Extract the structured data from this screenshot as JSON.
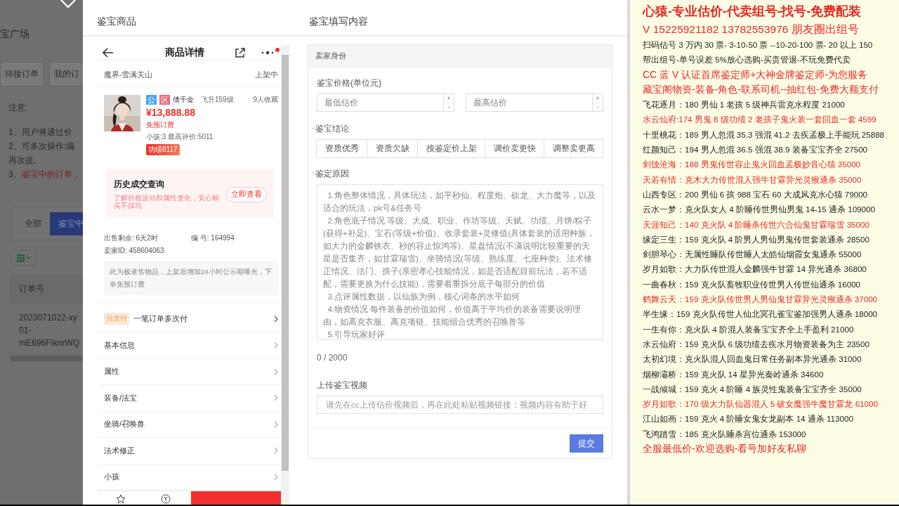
{
  "backdrop": {
    "page_title": "宝广场",
    "tabs": [
      "待接订单",
      "我的订"
    ],
    "notice_title": "注意:",
    "notice_lines": [
      {
        "number": "1、",
        "text": "用户将通过价",
        "kind": "normal"
      },
      {
        "number": "2、",
        "text": "可多次操作:编",
        "kind": "normal"
      },
      {
        "text": "再次提。",
        "kind": "normal"
      },
      {
        "number": "3、",
        "text": "鉴宝中的订单，",
        "kind": "warning"
      }
    ],
    "filters": [
      {
        "label": "全部",
        "selected": false
      },
      {
        "label": "鉴宝中",
        "selected": true
      }
    ],
    "table": {
      "columns": [
        "订单号"
      ],
      "rows": [
        [
          [
            "2023071022-xy",
            "01-",
            "mE696FIknrWQ"
          ]
        ]
      ]
    }
  },
  "modal": {
    "left_title": "鉴宝商品",
    "right_title": "鉴宝填写内容"
  },
  "product": {
    "header_title": "商品详情",
    "server": "魔界-雪满关山",
    "status": "上架中",
    "badges": [
      {
        "text": "公",
        "color": "#4aa8f0"
      },
      {
        "text": "区",
        "color": "#f06a7a"
      }
    ],
    "name": "倩千金",
    "level": "飞升159级",
    "favorites": "9人收藏",
    "price": "¥13,888.88",
    "fee": "免预订费",
    "stats": "小孩:3 最高评价:5011",
    "merit": "功绩8117",
    "history": {
      "title": "历史成交查询",
      "subtitle": "了解价格波动和属性变化，安心购买不踩坑",
      "button": "立即查看"
    },
    "remaining": "出售剩余: 6天2时",
    "serial": "编 号: 164994",
    "seller": "卖家ID: 458604063",
    "note": "此为极速售物品，上架后增加24小时公示期曝光，下单免预订费",
    "installment": {
      "badge": "分次付",
      "text": "一笔订单多次付"
    },
    "sections": [
      "基本信息",
      "属性",
      "装备/法宝",
      "坐骑/召唤兽",
      "法术修正",
      "小孩"
    ]
  },
  "form": {
    "section": "卖家身份",
    "price_label": "鉴宝价格(单位元)",
    "min_placeholder": "最低估价",
    "max_placeholder": "最高估价",
    "spin_up": "+",
    "spin_down": "-",
    "conclusion_label": "鉴宝结论",
    "required_mark": "*",
    "conclusions": [
      {
        "label": "资质优秀",
        "selected": false
      },
      {
        "label": "资质欠缺",
        "selected": false
      },
      {
        "label": "按鉴定价上架",
        "selected": false
      },
      {
        "label": "调价卖更快",
        "selected": false
      },
      {
        "label": "调整卖更高",
        "selected": false
      }
    ],
    "reason_label": "鉴定原因",
    "reason_placeholder": "  1.角色整体情况，具体玩法，如平秒仙、程度炮、砍龙、大力魔等，以及适合的玩法，pk号&任务号\n  2.角色底子情况 等级、大成、职业、作坊等级、天赋、功绩、月饼/粽子(获得+补足)、宝石(等级+价值)、收录套装+灵修值(具体套装的适用种族，如大力的金麟铁衣、秒的容止惊鸿等)、星盘情况(不满说明比较重要的天星是否集齐，如甘霖瑞雪)、坐骑情况(等级、熟练度、七座种类)、法术修正情况、法门、孩子(亲密孝心技能情况，如是否适配目前玩法，若不适配，需要更换为什么技能)，需要着重拆分底子每部分的价值\n  3.点评属性数据，以仙族为例，核心词条的水平如何\n  4.物资情况 每件装备的价值如何，价值高于平均价的装备需要说明理由，如高克衣服、高克项链、技能组合优秀的召唤兽等\n  5.引导玩家好评",
    "counter": "0 / 2000",
    "video_label": "上传鉴宝视频",
    "video_placeholder": "请先在cc上传估价视频后，再在此处粘贴视频链接；视频内容有助于好",
    "submit": "提交"
  },
  "notes": {
    "lines": [
      {
        "text": "心猿-专业估价-代卖组号-找号-免费配装",
        "color": "#e52b24",
        "kind": "title"
      },
      {
        "text": "V 15225921182   13782553976 朋友圈出组号",
        "color": "#e52b24",
        "kind": "subtitle"
      },
      {
        "text": "扫码估号 3 万内 30 票- 3-10-50 票  --10-20-100 票- 20 以上 150",
        "color": "#222222",
        "kind": "line"
      },
      {
        "text": "帮出组号-单号误差 5%放心选购-买贵管退-不玩免费代卖",
        "color": "#222222",
        "kind": "line"
      },
      {
        "text": "CC 蓝 V 认证首席鉴定师+大神金牌鉴定师-为您服务",
        "color": "#e52b24",
        "kind": "accent"
      },
      {
        "text": "藏宝阁物资-装备-角色-联系司机--抽红包-免费大额支付",
        "color": "#e52b24",
        "kind": "accent"
      },
      {
        "text": "飞花逐月：180 男仙 1 老孩 5 级神兵雷克水程度 21000",
        "color": "#222222",
        "kind": "line"
      },
      {
        "text": "水云仙府:174 男鬼 8 级功绩 2 老孩子鬼火装一套回血一套 4599",
        "color": "#e52b24",
        "kind": "line"
      },
      {
        "text": "十里桃花：189 男人忽混 35.3 强混 41.2 去疾孟极上手能玩 25888",
        "color": "#222222",
        "kind": "line"
      },
      {
        "text": "红颜知己：194 男人忽混 36.5 强混 38.9 装备宝宝齐全 27500",
        "color": "#222222",
        "kind": "line"
      },
      {
        "text": "剑蚀沧海：188 男鬼传世容止鬼火回血孟极妙音心猿 35000",
        "color": "#e52b24",
        "kind": "line"
      },
      {
        "text": "天若有情：克木大力传世混人强牛甘霖异光灵猴通杀 35000",
        "color": "#e52b24",
        "kind": "line"
      },
      {
        "text": "山西专区：200 男仙 6 孩 988 宝石 60 大成风克水心猿 79000",
        "color": "#222222",
        "kind": "line"
      },
      {
        "text": "云水一梦：克火队女人 4 阶睡传世男仙男鬼 14-15 通杀 109000",
        "color": "#222222",
        "kind": "line"
      },
      {
        "text": "天涯知己：140 克火队 4 阶睡杀传世六合仙鬼甘霖瑞雪 35000",
        "color": "#e52b24",
        "kind": "line"
      },
      {
        "text": "缘定三生：159 克火队 4 阶男人男仙男鬼传世套装通杀 28500",
        "color": "#222222",
        "kind": "line"
      },
      {
        "text": "剑胆琴心：无属性睡队传世睡人太皓仙烟霞女鬼通杀 55000",
        "color": "#222222",
        "kind": "line"
      },
      {
        "text": "岁月如歌：大力队传世混人金麟强牛甘霖 14 异光通杀 36800",
        "color": "#222222",
        "kind": "line"
      },
      {
        "text": "一曲春秋：159 克火队畜牧职业传世男人传世仙通杀 16000",
        "color": "#222222",
        "kind": "line"
      },
      {
        "text": "鹤舞云天：159 克火队传世男人男仙鬼甘霖异光灵猴通杀 37000",
        "color": "#e52b24",
        "kind": "line"
      },
      {
        "text": "半生缘：159 克火队传世人仙北冥孔雀宝鉴加强男人通杀 18000",
        "color": "#222222",
        "kind": "line"
      },
      {
        "text": "一生有你：克火队 4 阶混人装备宝宝齐全上手盈利 21000",
        "color": "#222222",
        "kind": "line"
      },
      {
        "text": "水云仙府：159 克火队 6 级功绩去疾水月物资装备为主 23500",
        "color": "#222222",
        "kind": "line"
      },
      {
        "text": "太初幻境：克火队混人回血鬼日常任务副本异光通杀 31000",
        "color": "#222222",
        "kind": "line"
      },
      {
        "text": "烟柳灞桥：159 克火队 14 星异光秦岭通杀 34600",
        "color": "#222222",
        "kind": "line"
      },
      {
        "text": "一战倾城：159 克火 4 阶睡 4 族灵性鬼装备宝宝齐全 35000",
        "color": "#222222",
        "kind": "line"
      },
      {
        "text": "岁月如歌：170 级大力队仙器混人 5 破女魔强牛魔甘霖龙 61000",
        "color": "#e52b24",
        "kind": "line"
      },
      {
        "text": "江山如画：159 克火 4 阶睡女鬼女龙副本 14 通杀 113000",
        "color": "#222222",
        "kind": "line"
      },
      {
        "text": "飞鸿踏雪：185 克火队睡杀宫位通杀 153000",
        "color": "#222222",
        "kind": "line"
      },
      {
        "text": "全服最低价-欢迎选购-看号加好友私聊",
        "color": "#e52b24",
        "kind": "accent"
      }
    ]
  }
}
